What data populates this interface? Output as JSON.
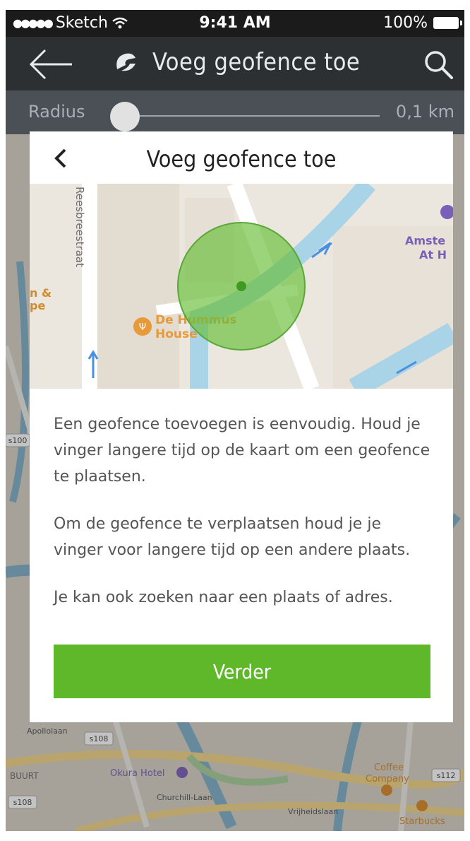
{
  "status_bar": {
    "carrier": "Sketch",
    "time": "9:41 AM",
    "battery": "100%"
  },
  "nav": {
    "title": "Voeg geofence toe",
    "back_icon": "arrow-left-icon",
    "logo_icon": "geofence-logo-icon",
    "search_icon": "search-icon"
  },
  "radius": {
    "label": "Radius",
    "value": "0,1 km",
    "slider_fraction": 0.05
  },
  "modal": {
    "title": "Voeg geofence toe",
    "paragraphs": [
      "Een geofence toevoegen is eenvoudig. Houd je vinger langere tijd op de kaart om een geofence te plaatsen.",
      "Om de geofence te verplaatsen houd je je vinger voor langere tijd op een andere plaats.",
      "Je kan ook zoeken naar een plaats of adres."
    ],
    "button_label": "Verder",
    "map_labels": {
      "street": "Reesbreestraat",
      "poi_name_1": "De Hummus",
      "poi_name_2": "House",
      "poi_right_1": "Amste",
      "poi_right_2": "At H",
      "poi_left_1": "n &",
      "poi_left_2": "pe"
    }
  },
  "background_map": {
    "labels": {
      "road_badge_1": "s108",
      "road_badge_2": "s108",
      "road_badge_3": "s112",
      "road_badge_4": "s100",
      "hotel": "Okura Hotel",
      "coffee": "Coffee",
      "company": "Company",
      "starbucks": "Starbucks",
      "buurt": "BUURT",
      "churchill": "Churchill-Laan",
      "vrijheidslaan": "Vrijheidslaan",
      "apollolaan": "Apollolaan"
    }
  },
  "colors": {
    "accent_green": "#5fb82a",
    "nav_bg": "#2c3033",
    "radius_bg": "#4a5056"
  }
}
